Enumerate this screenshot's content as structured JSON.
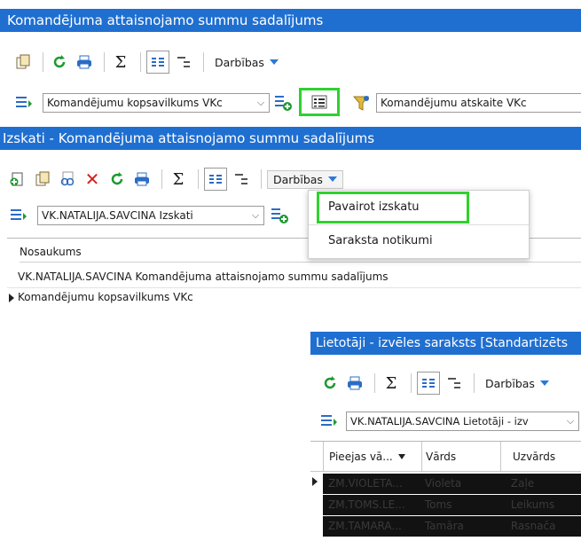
{
  "window1": {
    "title": "Komandējuma attaisnojamo summu sadalījums",
    "actions_label": "Darbības",
    "report_combo": "Komandējumu kopsavilkums VKc",
    "filter_combo": "Komandējumu atskaite VKc"
  },
  "window2": {
    "title": "Izskati - Komandējuma attaisnojamo summu sadalījums",
    "actions_label": "Darbības",
    "view_combo": "VK.NATALIJA.SAVCINA Izskati",
    "menu": [
      "Pavairot izskatu",
      "Saraksta notikumi"
    ],
    "column_header": "Nosaukums",
    "rows": [
      "VK.NATALIJA.SAVCINA Komandējuma attaisnojamo summu sadalījums",
      "Komandējumu kopsavilkums VKc"
    ]
  },
  "window3": {
    "title": "Lietotāji - izvēles saraksts [Standartizēts",
    "actions_label": "Darbības",
    "view_combo": "VK.NATALIJA.SAVCINA Lietotāji - izv",
    "columns": [
      "Pieejas vā...",
      "Vārds",
      "Uzvārds"
    ],
    "rows": [
      [
        "ZM.VIOLETA...",
        "Violeta",
        "Zaļe"
      ],
      [
        "ZM.TOMS.LE...",
        "Toms",
        "Leikums"
      ],
      [
        "ZM.TAMARA...",
        "Tamāra",
        "Rasnača"
      ]
    ]
  },
  "colors": {
    "titlebar": "#1f6fd1",
    "highlight": "#2fd12f",
    "accent": "#2b78d8"
  }
}
